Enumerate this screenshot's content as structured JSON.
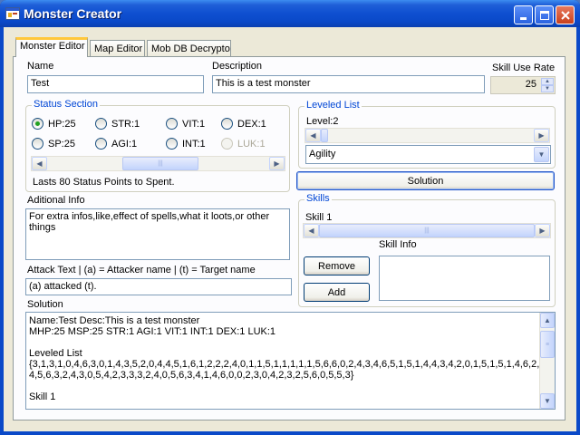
{
  "window": {
    "title": "Monster Creator"
  },
  "tabs": [
    {
      "label": "Monster Editor"
    },
    {
      "label": "Map Editor"
    },
    {
      "label": "Mob DB Decrypto"
    }
  ],
  "fields": {
    "name_label": "Name",
    "name_value": "Test",
    "description_label": "Description",
    "description_value": "This is a test monster",
    "skill_use_rate_label": "Skill Use Rate",
    "skill_use_rate_value": "25"
  },
  "status_section": {
    "title": "Status Section",
    "stats": [
      {
        "label": "HP:25",
        "checked": true
      },
      {
        "label": "STR:1",
        "checked": false
      },
      {
        "label": "VIT:1",
        "checked": false
      },
      {
        "label": "DEX:1",
        "checked": false
      },
      {
        "label": "SP:25",
        "checked": false
      },
      {
        "label": "AGI:1",
        "checked": false
      },
      {
        "label": "INT:1",
        "checked": false
      },
      {
        "label": "LUK:1",
        "checked": false,
        "disabled": true
      }
    ],
    "points_text": "Lasts 80 Status Points to Spent."
  },
  "leveled_list": {
    "title": "Leveled List",
    "level_label": "Level:2",
    "selected": "Agility"
  },
  "solution_button": "Solution",
  "skills": {
    "title": "Skills",
    "skill_label": "Skill 1",
    "info_label": "Skill Info",
    "remove_button": "Remove",
    "add_button": "Add"
  },
  "additional_info": {
    "label": "Aditional Info",
    "value": "For extra infos,like,effect of spells,what it loots,or other things"
  },
  "attack_text": {
    "label": "Attack Text  |  (a) = Attacker name | (t) = Target name",
    "value": "(a) attacked (t)."
  },
  "solution": {
    "label": "Solution",
    "lines": [
      "Name:Test    Desc:This is a test monster",
      "MHP:25 MSP:25 STR:1 AGI:1 VIT:1 INT:1 DEX:1 LUK:1",
      "",
      "Leveled List",
      "{3,1,3,1,0,4,6,3,0,1,4,3,5,2,0,4,4,5,1,6,1,2,2,2,4,0,1,1,5,1,1,1,1,1,5,6,6,0,2,4,3,4,6,5,1,5,1,4,4,3,4,2,0,1,5,1,5,1,4,6,2,4,",
      "4,5,6,3,2,4,3,0,5,4,2,3,3,3,2,4,0,5,6,3,4,1,4,6,0,0,2,3,0,4,2,3,2,5,6,0,5,5,3}",
      "",
      "Skill 1"
    ]
  },
  "icons": {
    "app": "form-app-icon",
    "minimize": "minimize-icon",
    "maximize": "maximize-icon",
    "close": "close-icon"
  },
  "colors": {
    "title_bar": "#0a49c8",
    "group_title": "#0046d5",
    "panel": "#ece9d8"
  }
}
